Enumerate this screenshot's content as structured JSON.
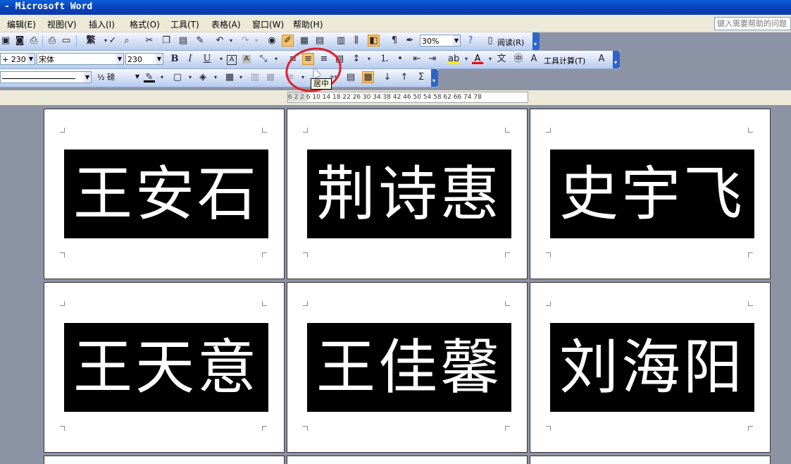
{
  "window": {
    "title": "- Microsoft Word"
  },
  "menu": [
    "编辑(E)",
    "视图(V)",
    "插入(I)",
    "格式(O)",
    "工具(T)",
    "表格(A)",
    "窗口(W)",
    "帮助(H)"
  ],
  "help_box": {
    "placeholder": "键入需要帮助的问题"
  },
  "toolbar_standard": {
    "zoom": "30%",
    "read_label": "阅读(R)",
    "traditional_label": "繁"
  },
  "toolbar_format": {
    "style": "+ 230",
    "font": "宋体",
    "size": "230",
    "calc_label": "工具计算(T)"
  },
  "toolbar_tables": {
    "line_weight": "½ 磅"
  },
  "tooltip": "居中",
  "ruler": {
    "ticks": "6   2   2   6  10  14  18  22  26  30  34  38  42  46  50  54  58  62  66     74  78"
  },
  "labels": [
    "王安石",
    "荆诗惠",
    "史宇飞",
    "王天意",
    "王佳馨",
    "刘海阳"
  ]
}
